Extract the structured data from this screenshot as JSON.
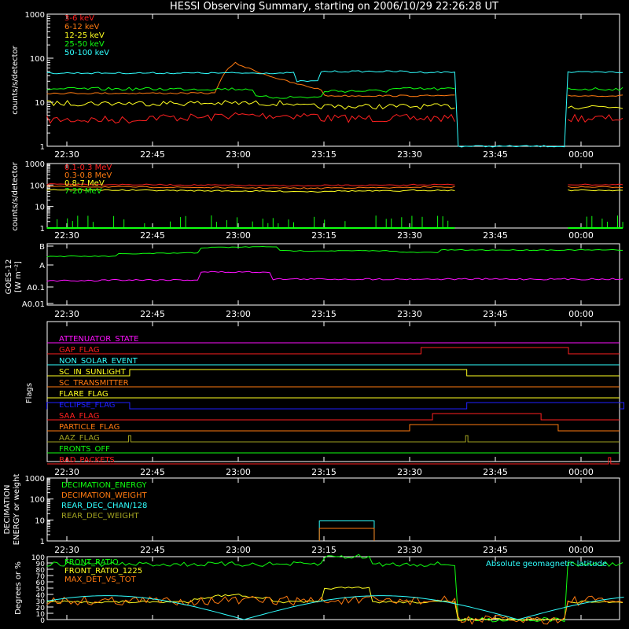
{
  "title": "HESSI Observing Summary, starting on 2006/10/29 22:26:28 UT",
  "time_ticks": [
    "22:30",
    "22:45",
    "23:00",
    "23:15",
    "23:30",
    "23:45",
    "00:00"
  ],
  "colors": {
    "red": "#ff2020",
    "orange": "#ff7a10",
    "yellow": "#ffff20",
    "green": "#10ff10",
    "cyan": "#30ffff",
    "magenta": "#ff10ff",
    "blue": "#2020ff",
    "olive": "#a0a020",
    "white": "#ffffff"
  },
  "chart_data": [
    {
      "type": "line",
      "ylabel": "counts/s/detector",
      "yscale": "log",
      "ylim": [
        1,
        1000
      ],
      "y_ticks": [
        "1",
        "10",
        "100",
        "1000"
      ],
      "x": [
        "22:30",
        "22:45",
        "23:00",
        "23:15",
        "23:30",
        "23:45",
        "00:00"
      ],
      "series": [
        {
          "name": "3-6 keV",
          "color": "red",
          "values": [
            4,
            4,
            5,
            4,
            4,
            null,
            4
          ]
        },
        {
          "name": "6-12 keV",
          "color": "orange",
          "values": [
            18,
            18,
            30,
            14,
            13,
            null,
            16
          ]
        },
        {
          "name": "12-25 keV",
          "color": "yellow",
          "values": [
            9,
            8,
            8,
            8,
            7,
            null,
            8
          ]
        },
        {
          "name": "25-50 keV",
          "color": "green",
          "values": [
            20,
            19,
            20,
            12,
            18,
            null,
            20
          ]
        },
        {
          "name": "50-100 keV",
          "color": "cyan",
          "values": [
            46,
            44,
            44,
            44,
            52,
            1,
            46
          ]
        }
      ]
    },
    {
      "type": "line",
      "ylabel": "counts/s/detector",
      "yscale": "log",
      "ylim": [
        1,
        1000
      ],
      "y_ticks": [
        "1",
        "10",
        "100",
        "1000"
      ],
      "x": [
        "22:30",
        "22:45",
        "23:00",
        "23:15",
        "23:30",
        "23:45",
        "00:00"
      ],
      "series": [
        {
          "name": "0.1-0.3 MeV",
          "color": "red",
          "values": [
            100,
            98,
            95,
            85,
            95,
            null,
            95
          ]
        },
        {
          "name": "0.3-0.8 MeV",
          "color": "orange",
          "values": [
            80,
            76,
            72,
            65,
            72,
            null,
            72
          ]
        },
        {
          "name": "0.8-7 MeV",
          "color": "yellow",
          "values": [
            60,
            55,
            50,
            45,
            50,
            null,
            55
          ]
        },
        {
          "name": "7-20 MeV",
          "color": "green",
          "values": [
            1,
            1,
            1,
            1,
            1,
            null,
            1
          ]
        }
      ]
    },
    {
      "type": "line",
      "ylabel": "GOES-12 [W m-2]",
      "y_ticks": [
        "A0.01",
        "A0.1",
        "A",
        "B"
      ],
      "x": [
        "22:30",
        "22:45",
        "23:00",
        "23:15",
        "23:30",
        "23:45",
        "00:00"
      ],
      "series": [
        {
          "color": "green",
          "values": [
            0.9,
            0.9,
            1.0,
            0.95,
            0.9,
            0.92,
            0.95
          ]
        },
        {
          "color": "magenta",
          "values": [
            0.1,
            0.1,
            0.25,
            0.1,
            0.1,
            0.1,
            0.1
          ]
        }
      ]
    },
    {
      "type": "line",
      "ylabel": "Flags",
      "flags": [
        {
          "name": "ATTENUATOR_STATE",
          "color": "magenta"
        },
        {
          "name": "GAP_FLAG",
          "color": "red"
        },
        {
          "name": "NON_SOLAR_EVENT",
          "color": "cyan"
        },
        {
          "name": "SC_IN_SUNLIGHT",
          "color": "yellow"
        },
        {
          "name": "SC_TRANSMITTER",
          "color": "orange"
        },
        {
          "name": "FLARE_FLAG",
          "color": "yellow"
        },
        {
          "name": "ECLIPSE_FLAG",
          "color": "blue"
        },
        {
          "name": "SAA_FLAG",
          "color": "red"
        },
        {
          "name": "PARTICLE_FLAG",
          "color": "orange"
        },
        {
          "name": "AAZ_FLAG",
          "color": "olive"
        },
        {
          "name": "FRONTS_OFF",
          "color": "green"
        },
        {
          "name": "BAD_PACKETS",
          "color": "red"
        }
      ]
    },
    {
      "type": "line",
      "ylabel": "DECIMATION ENERGY or weight",
      "yscale": "log",
      "ylim": [
        1,
        1000
      ],
      "y_ticks": [
        "1",
        "10",
        "100",
        "1000"
      ],
      "series": [
        {
          "name": "DECIMATION_ENERGY",
          "color": "green"
        },
        {
          "name": "DECIMATION_WEIGHT",
          "color": "orange"
        },
        {
          "name": "REAR_DEC_CHAN/128",
          "color": "cyan"
        },
        {
          "name": "REAR_DEC_WEIGHT",
          "color": "olive"
        }
      ]
    },
    {
      "type": "line",
      "ylabel": "Degrees or %",
      "ylim": [
        0,
        100
      ],
      "y_ticks": [
        "0",
        "10",
        "20",
        "30",
        "40",
        "50",
        "60",
        "70",
        "80",
        "90",
        "100"
      ],
      "annotation": "Absolute geomagnetic latitude",
      "series": [
        {
          "name": "FRONT_RATIO",
          "color": "green"
        },
        {
          "name": "FRONT_RATIO_1225",
          "color": "yellow"
        },
        {
          "name": "MAX_DET_VS_TOT",
          "color": "orange"
        }
      ]
    }
  ]
}
